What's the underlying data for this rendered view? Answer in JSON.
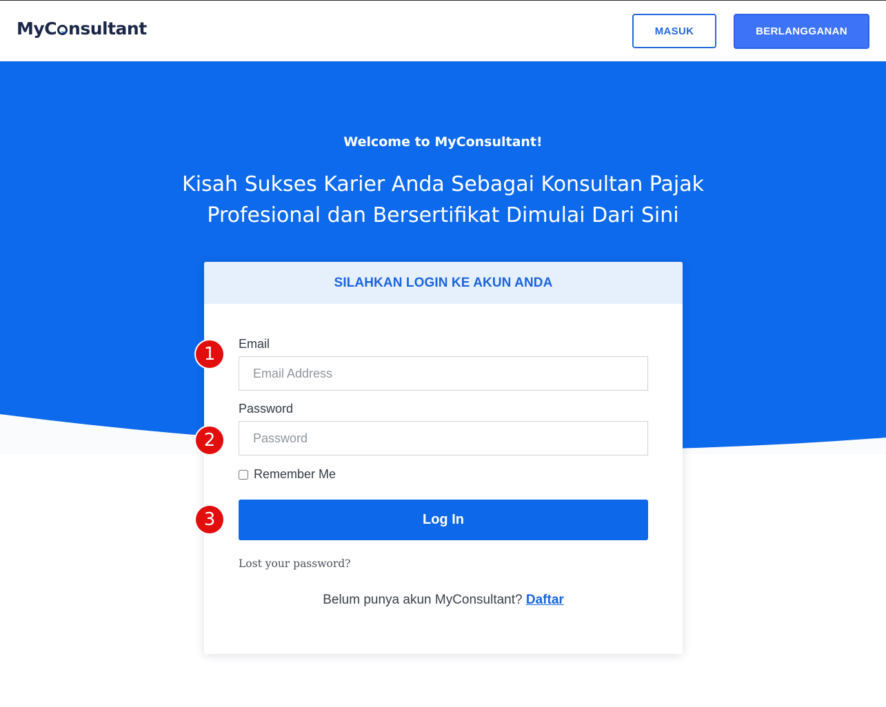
{
  "header": {
    "logo_prefix": "My",
    "logo_suffix": "nsultant",
    "masuk_label": "MASUK",
    "berlangganan_label": "BERLANGGANAN"
  },
  "hero": {
    "welcome": "Welcome to MyConsultant!",
    "headline_line1": "Kisah Sukses Karier Anda Sebagai Konsultan Pajak",
    "headline_line2": "Profesional dan Bersertifikat Dimulai Dari Sini"
  },
  "login": {
    "title": "SILAHKAN LOGIN KE AKUN ANDA",
    "email_label": "Email",
    "email_placeholder": "Email Address",
    "email_value": "",
    "password_label": "Password",
    "password_placeholder": "Password",
    "password_value": "",
    "remember_label": "Remember Me",
    "remember_checked": false,
    "login_button": "Log In",
    "lost_password": "Lost your password?",
    "signup_prompt": "Belum punya akun MyConsultant?",
    "signup_link": "Daftar"
  },
  "markers": {
    "m1": "1",
    "m2": "2",
    "m3": "3"
  },
  "colors": {
    "brand_blue": "#0d6aec",
    "marker_red": "#e20d0d",
    "logo_navy": "#1c2648"
  }
}
